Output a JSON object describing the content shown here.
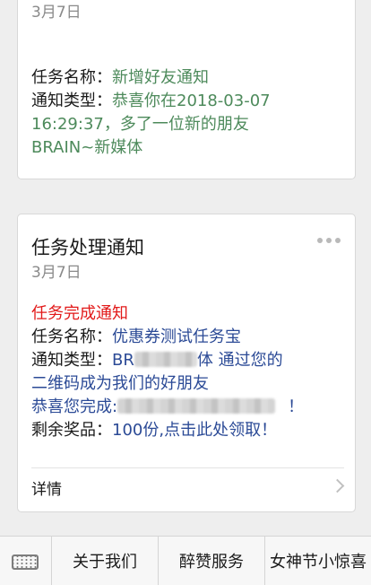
{
  "card1": {
    "date": "3月7日",
    "task_name_key": "任务名称：",
    "task_name_value": "新增好友通知",
    "notice_type_key": "通知类型：",
    "notice_type_value_1": "恭喜你在2018-03-07",
    "notice_type_value_2": "16:29:37，多了一位新的朋友",
    "notice_type_value_3": "BRAIN~新媒体"
  },
  "card2": {
    "title": "任务处理通知",
    "date": "3月7日",
    "headline": "任务完成通知",
    "task_name_key": "任务名称：",
    "task_name_value": "优惠券测试任务宝",
    "notice_type_key": "通知类型：",
    "notice_type_value_prefix": "BR",
    "notice_type_value_suffix": "体 通过您的",
    "notice_line2": "二维码成为我们的好朋友",
    "congrats_prefix": "恭喜您完成:",
    "congrats_suffix": "！",
    "prize_key": "剩余奖品：",
    "prize_value": "100份,点击此处领取！",
    "detail_label": "详情"
  },
  "colors": {
    "green": "#4d8a5b",
    "blue": "#2b4a96",
    "red": "#e21a1a"
  },
  "tabbar": {
    "keyboard_icon": "keyboard-icon",
    "tabs": [
      "关于我们",
      "醉赞服务",
      "女神节小惊喜"
    ]
  }
}
